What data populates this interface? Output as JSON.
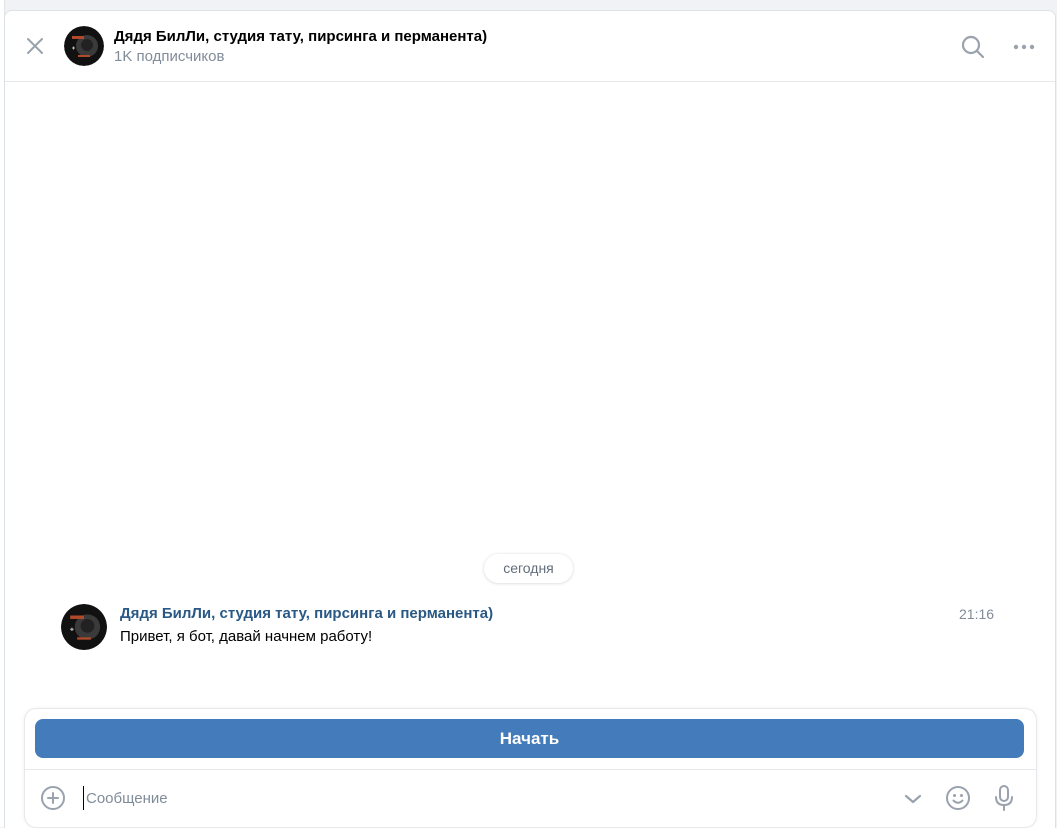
{
  "header": {
    "title": "Дядя БилЛи, студия тату, пирсинга и перманента)",
    "subscribers": "1K подписчиков"
  },
  "history": {
    "date_separator": "сегодня",
    "messages": [
      {
        "author": "Дядя БилЛи, студия тату, пирсинга и перманента)",
        "time": "21:16",
        "text": "Привет, я бот, давай начнем работу!"
      }
    ]
  },
  "composer": {
    "keyboard_button": "Начать",
    "placeholder": "Сообщение",
    "value": ""
  },
  "colors": {
    "accent": "#447bba",
    "author_link": "#2a5885",
    "secondary_text": "#818c99",
    "icon": "#99a2ad"
  },
  "icons": {
    "close": "close-icon",
    "search": "search-icon",
    "more": "more-horizontal-icon",
    "attach": "add-circle-icon",
    "expand": "chevron-down-icon",
    "emoji": "smile-icon",
    "voice": "microphone-icon"
  }
}
